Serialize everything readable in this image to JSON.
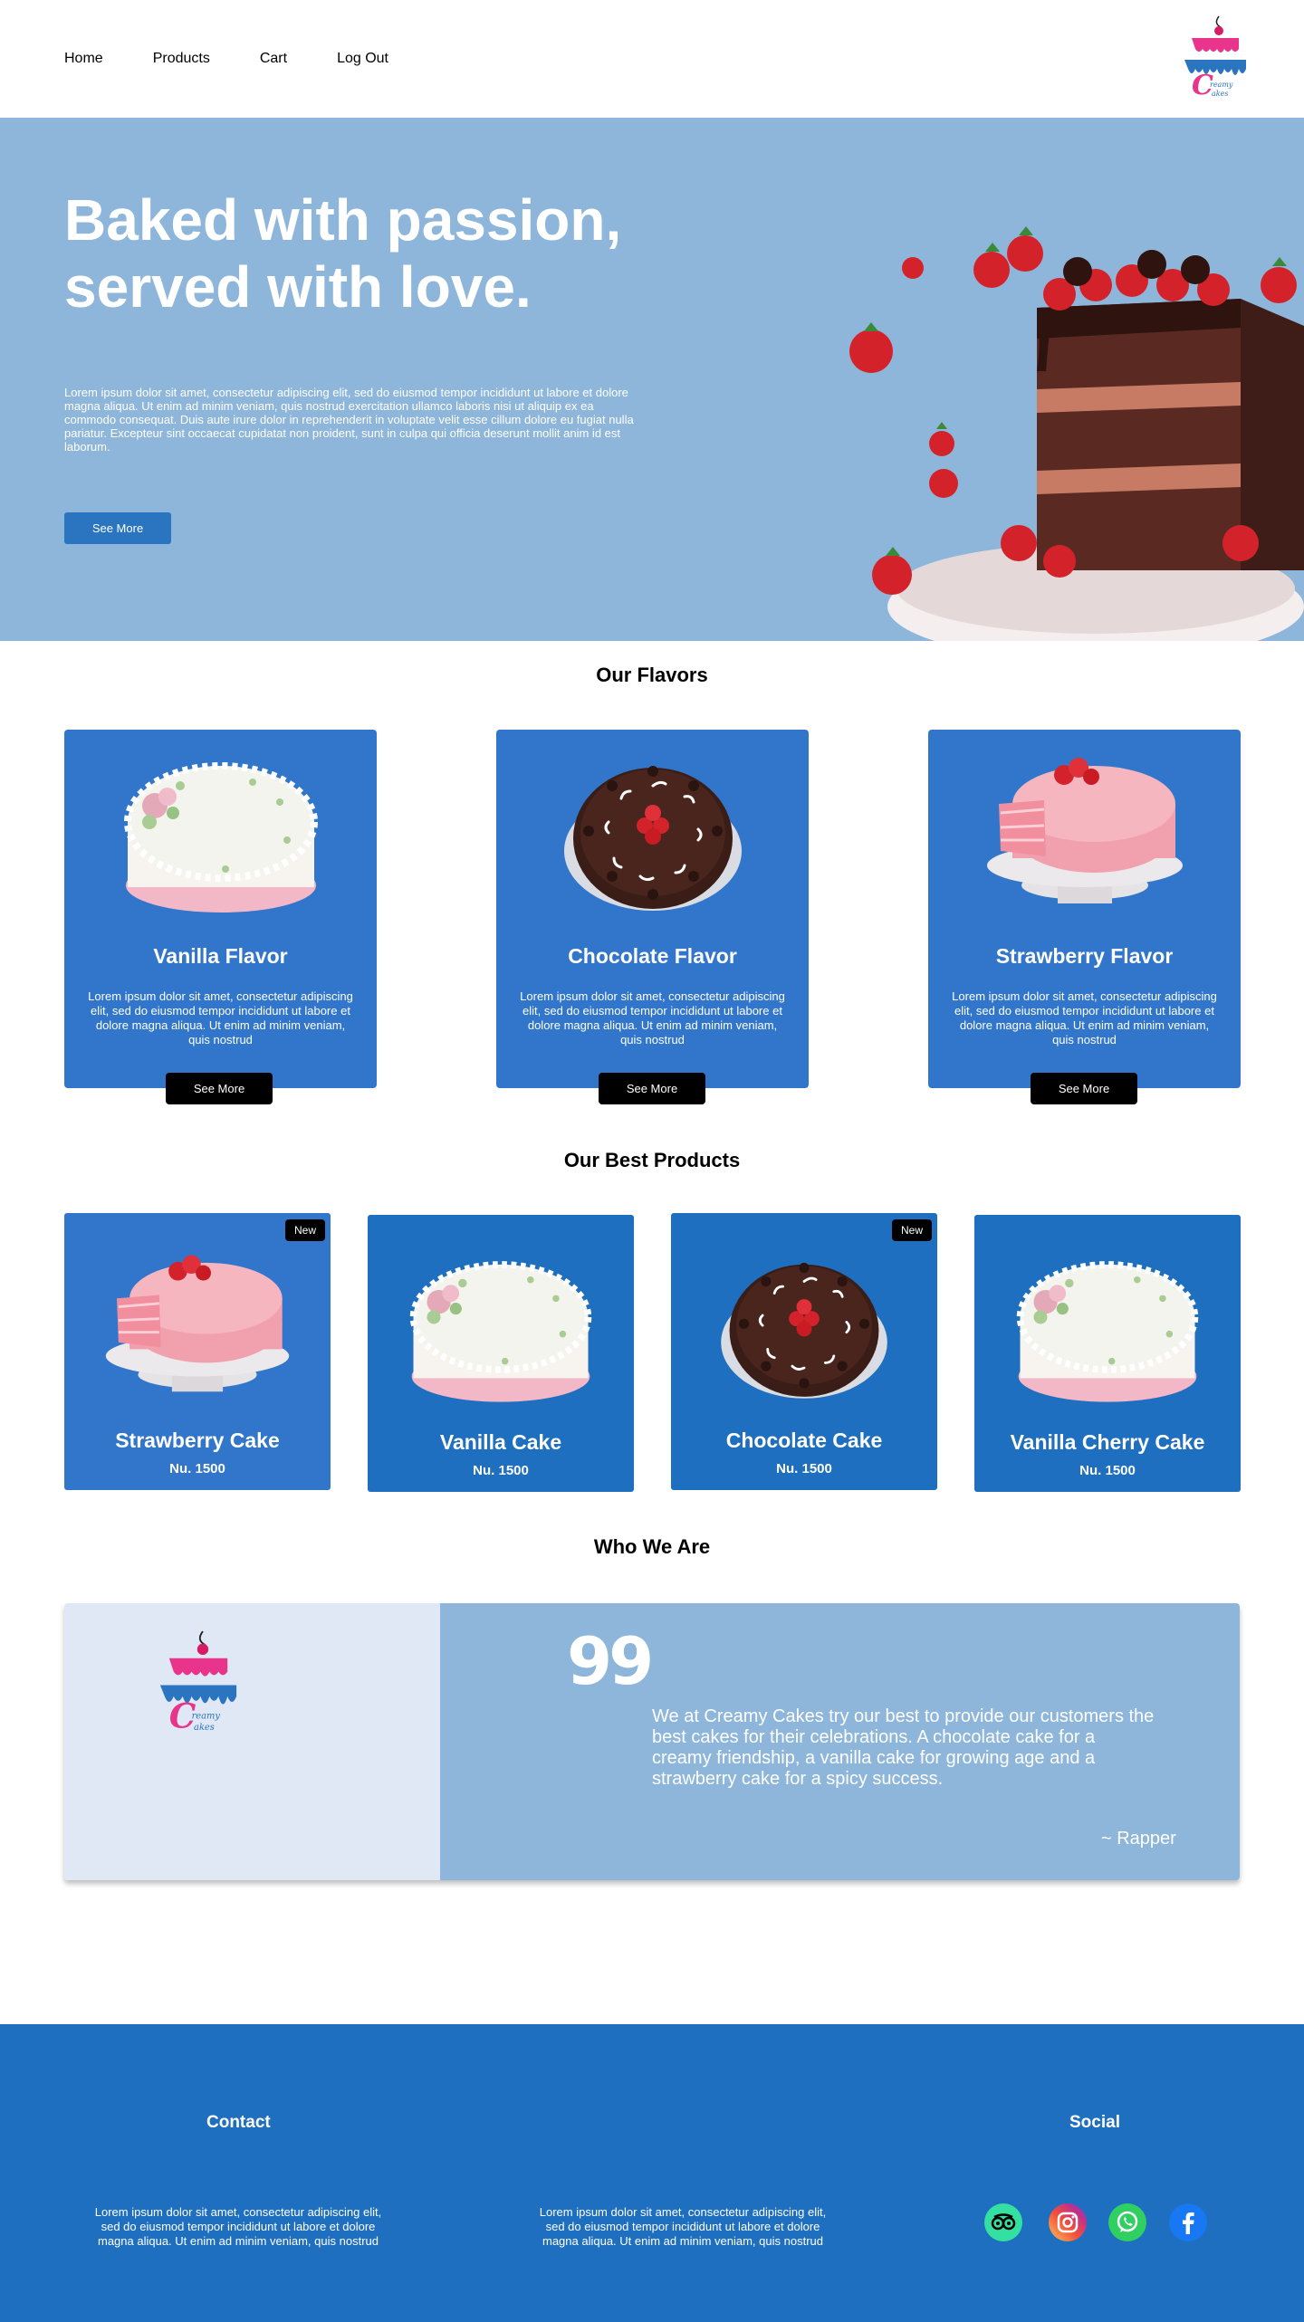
{
  "nav": {
    "links": [
      "Home",
      "Products",
      "Cart",
      "Log Out"
    ],
    "logo_text": "Creamy Cakes"
  },
  "hero": {
    "title_line1": "Baked with passion,",
    "title_line2": "served with love.",
    "text": "Lorem ipsum dolor sit amet, consectetur adipiscing elit, sed do eiusmod tempor incididunt ut labore et dolore magna aliqua. Ut enim ad minim veniam, quis nostrud exercitation ullamco laboris nisi ut aliquip ex ea commodo consequat. Duis aute irure dolor in reprehenderit in voluptate velit esse cillum dolore eu fugiat nulla pariatur. Excepteur sint occaecat cupidatat non proident, sunt in culpa qui officia deserunt mollit anim id est laborum.",
    "button": "See More"
  },
  "flavors": {
    "title": "Our Flavors",
    "items": [
      {
        "name": "Vanilla Flavor",
        "desc": "Lorem ipsum dolor sit amet, consectetur adipiscing elit, sed do eiusmod tempor incididunt ut labore et dolore magna aliqua. Ut enim ad minim veniam, quis nostrud",
        "button": "See More"
      },
      {
        "name": "Chocolate Flavor",
        "desc": "Lorem ipsum dolor sit amet, consectetur adipiscing elit, sed do eiusmod tempor incididunt ut labore et dolore magna aliqua. Ut enim ad minim veniam, quis nostrud",
        "button": "See More"
      },
      {
        "name": "Strawberry Flavor",
        "desc": "Lorem ipsum dolor sit amet, consectetur adipiscing elit, sed do eiusmod tempor incididunt ut labore et dolore magna aliqua. Ut enim ad minim veniam, quis nostrud",
        "button": "See More"
      }
    ]
  },
  "products": {
    "title": "Our Best Products",
    "items": [
      {
        "name": "Strawberry Cake",
        "price": "Nu. 1500",
        "badge": "New"
      },
      {
        "name": "Vanilla Cake",
        "price": "Nu. 1500",
        "badge": ""
      },
      {
        "name": "Chocolate Cake",
        "price": "Nu. 1500",
        "badge": "New"
      },
      {
        "name": "Vanilla Cherry Cake",
        "price": "Nu. 1500",
        "badge": ""
      }
    ]
  },
  "who": {
    "title": "Who We Are",
    "quote_mark": "99",
    "text": "We at Creamy Cakes try our best to provide our customers the best cakes for their celebrations. A chocolate cake for a creamy friendship, a vanilla cake for growing age and a strawberry cake for a spicy success.",
    "author": "~ Rapper"
  },
  "footer": {
    "contact_title": "Contact",
    "social_title": "Social",
    "text1": "Lorem ipsum dolor sit amet, consectetur adipiscing elit, sed do eiusmod tempor incididunt ut labore et dolore magna aliqua. Ut enim ad minim veniam, quis nostrud",
    "text2": "Lorem ipsum dolor sit amet, consectetur adipiscing elit, sed do eiusmod tempor incididunt ut labore et dolore magna aliqua. Ut enim ad minim veniam, quis nostrud",
    "social_icons": [
      "tripadvisor-icon",
      "instagram-icon",
      "whatsapp-icon",
      "facebook-icon"
    ]
  },
  "colors": {
    "hero_bg": "#8db6da",
    "card_blue": "#3176cb",
    "footer_blue": "#1e6fbf",
    "button_blue": "#2a74c0"
  }
}
